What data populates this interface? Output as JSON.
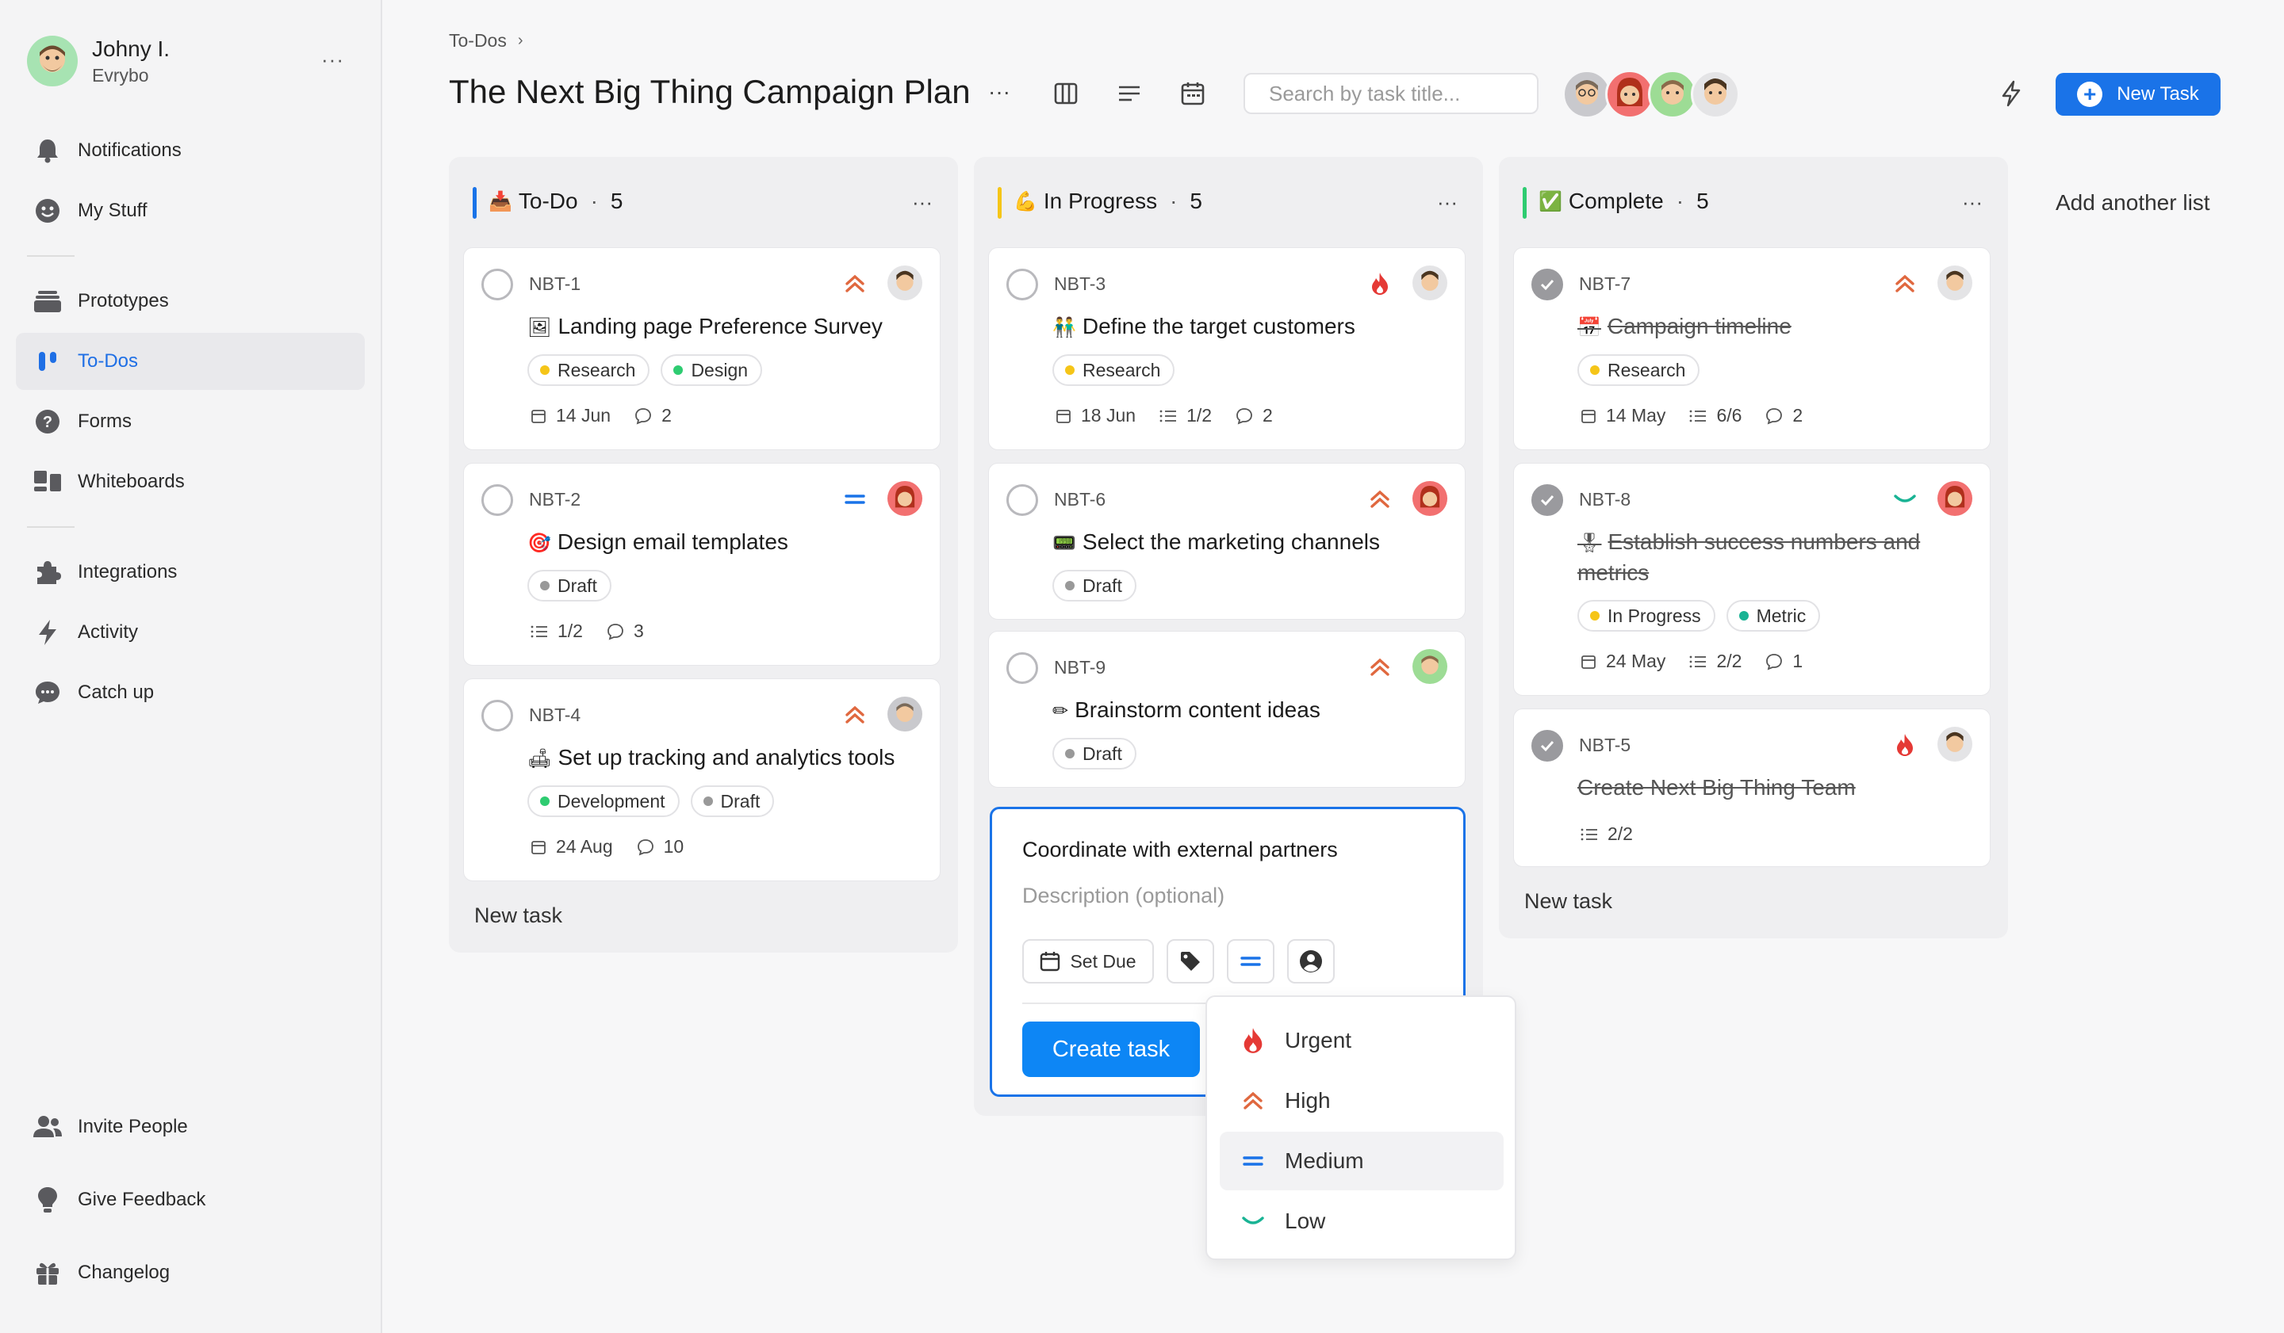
{
  "user": {
    "name": "Johny I.",
    "org": "Evrybo"
  },
  "nav": {
    "notifications": "Notifications",
    "my_stuff": "My Stuff",
    "prototypes": "Prototypes",
    "todos": "To-Dos",
    "forms": "Forms",
    "whiteboards": "Whiteboards",
    "integrations": "Integrations",
    "activity": "Activity",
    "catch_up": "Catch up",
    "invite": "Invite People",
    "feedback": "Give Feedback",
    "changelog": "Changelog"
  },
  "header": {
    "breadcrumb": "To-Dos",
    "title": "The Next Big Thing Campaign Plan",
    "search_placeholder": "Search by task title...",
    "new_task": "New Task"
  },
  "colors": {
    "accent": "#1a73e8",
    "urgent": "#e53935",
    "high": "#e0683f",
    "medium": "#1a73e8",
    "low": "#19b394"
  },
  "columns": [
    {
      "name": "To-Do",
      "count": "5",
      "emoji": "📥",
      "color": "#1a73e8",
      "cards": [
        {
          "id": "NBT-1",
          "emoji": "🖼",
          "title": "Landing page Preference Survey",
          "priority": "high",
          "tags": [
            {
              "label": "Research",
              "color": "#f5c518"
            },
            {
              "label": "Design",
              "color": "#2ecc71"
            }
          ],
          "due": "14 Jun",
          "subtasks": "",
          "comments": "2"
        },
        {
          "id": "NBT-2",
          "emoji": "🎯",
          "title": "Design email templates",
          "priority": "medium",
          "tags": [
            {
              "label": "Draft",
              "color": "#999999"
            }
          ],
          "due": "",
          "subtasks": "1/2",
          "comments": "3"
        },
        {
          "id": "NBT-4",
          "emoji": "🛋",
          "title": "Set up tracking and analytics tools",
          "priority": "high",
          "tags": [
            {
              "label": "Development",
              "color": "#2ecc71"
            },
            {
              "label": "Draft",
              "color": "#999999"
            }
          ],
          "due": "24 Aug",
          "subtasks": "",
          "comments": "10"
        }
      ],
      "new_task": "New task"
    },
    {
      "name": "In Progress",
      "count": "5",
      "emoji": "💪",
      "color": "#f5c518",
      "cards": [
        {
          "id": "NBT-3",
          "emoji": "👬",
          "title": "Define the target customers",
          "priority": "urgent",
          "tags": [
            {
              "label": "Research",
              "color": "#f5c518"
            }
          ],
          "due": "18 Jun",
          "subtasks": "1/2",
          "comments": "2"
        },
        {
          "id": "NBT-6",
          "emoji": "📟",
          "title": "Select the marketing channels",
          "priority": "high",
          "tags": [
            {
              "label": "Draft",
              "color": "#999999"
            }
          ],
          "due": "",
          "subtasks": "",
          "comments": ""
        },
        {
          "id": "NBT-9",
          "emoji": "✏",
          "title": "Brainstorm content ideas",
          "priority": "high",
          "tags": [
            {
              "label": "Draft",
              "color": "#999999"
            }
          ],
          "due": "",
          "subtasks": "",
          "comments": ""
        }
      ]
    },
    {
      "name": "Complete",
      "count": "5",
      "emoji": "✅",
      "color": "#2ecc71",
      "cards": [
        {
          "id": "NBT-7",
          "emoji": "📅",
          "title": "Campaign timeline",
          "priority": "high",
          "tags": [
            {
              "label": "Research",
              "color": "#f5c518"
            }
          ],
          "due": "14 May",
          "subtasks": "6/6",
          "comments": "2"
        },
        {
          "id": "NBT-8",
          "emoji": "🎖",
          "title": "Establish success numbers and metrics",
          "priority": "low",
          "tags": [
            {
              "label": "In Progress",
              "color": "#f5c518"
            },
            {
              "label": "Metric",
              "color": "#19b394"
            }
          ],
          "due": "24 May",
          "subtasks": "2/2",
          "comments": "1"
        },
        {
          "id": "NBT-5",
          "emoji": "",
          "title": "Create Next Big Thing Team",
          "priority": "urgent",
          "tags": [],
          "due": "",
          "subtasks": "2/2",
          "comments": ""
        }
      ],
      "new_task": "New task"
    }
  ],
  "add_list": "Add another list",
  "composer": {
    "title": "Coordinate with external partners",
    "desc_placeholder": "Description (optional)",
    "set_due": "Set Due",
    "create": "Create task"
  },
  "priority_menu": {
    "urgent": "Urgent",
    "high": "High",
    "medium": "Medium",
    "low": "Low",
    "selected": "Medium"
  }
}
